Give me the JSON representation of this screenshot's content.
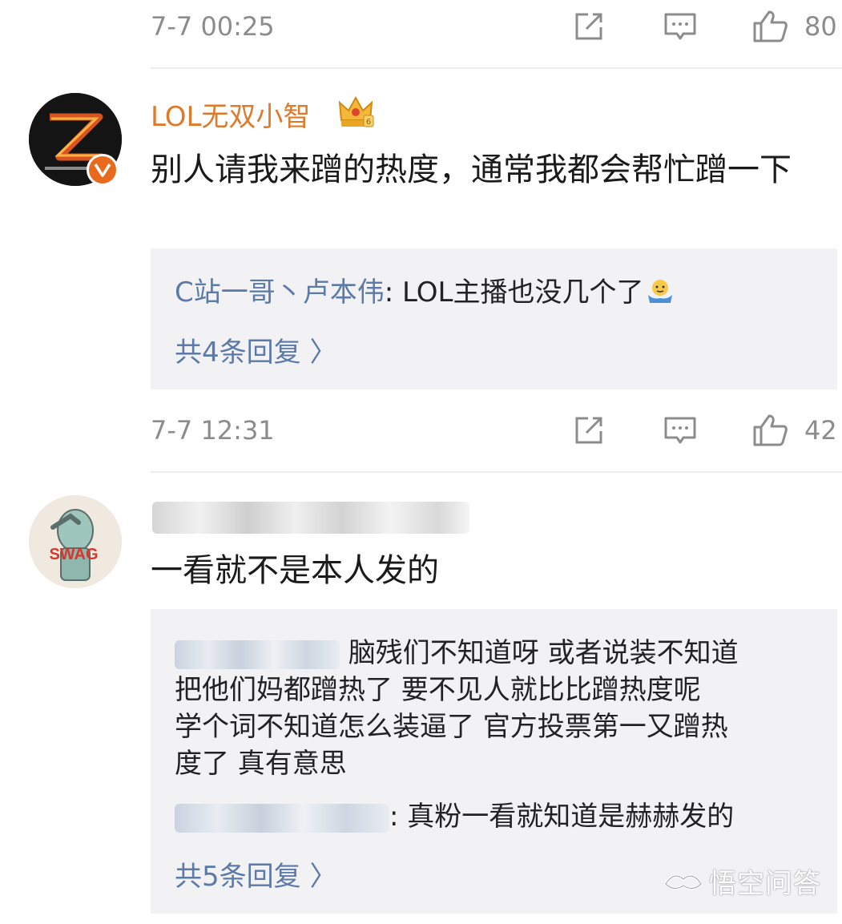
{
  "top_bar": {
    "time": "7-7 00:25",
    "like_count": "80"
  },
  "comments": [
    {
      "username": "LOL无双小智",
      "content": "别人请我来蹭的热度，通常我都会帮忙蹭一下",
      "replies": [
        {
          "name": "C站一哥丶卢本伟",
          "text": ": LOL主播也没几个了"
        }
      ],
      "more_label": "共4条回复 〉",
      "time": "7-7 12:31",
      "like_count": "42"
    },
    {
      "username": "",
      "content": "一看就不是本人发的",
      "replies": [
        {
          "text_lines": [
            "脑残们不知道呀 或者说装不知道",
            "把他们妈都蹭热了 要不见人就比比蹭热度呢",
            "学个词不知道怎么装逼了 官方投票第一又蹭热",
            "度了 真有意思"
          ]
        },
        {
          "text": ": 真粉一看就知道是赫赫发的"
        }
      ],
      "more_label": "共5条回复 〉"
    }
  ],
  "watermark": "悟空问答",
  "colors": {
    "username": "#e07a2b",
    "reply_name": "#5b7aa8",
    "meta": "#8c8c8c",
    "reply_bg": "#f2f2f4"
  },
  "icons": [
    "share-icon",
    "comment-icon",
    "like-icon",
    "crown-badge-icon",
    "verified-badge-icon",
    "wukong-logo-icon"
  ]
}
